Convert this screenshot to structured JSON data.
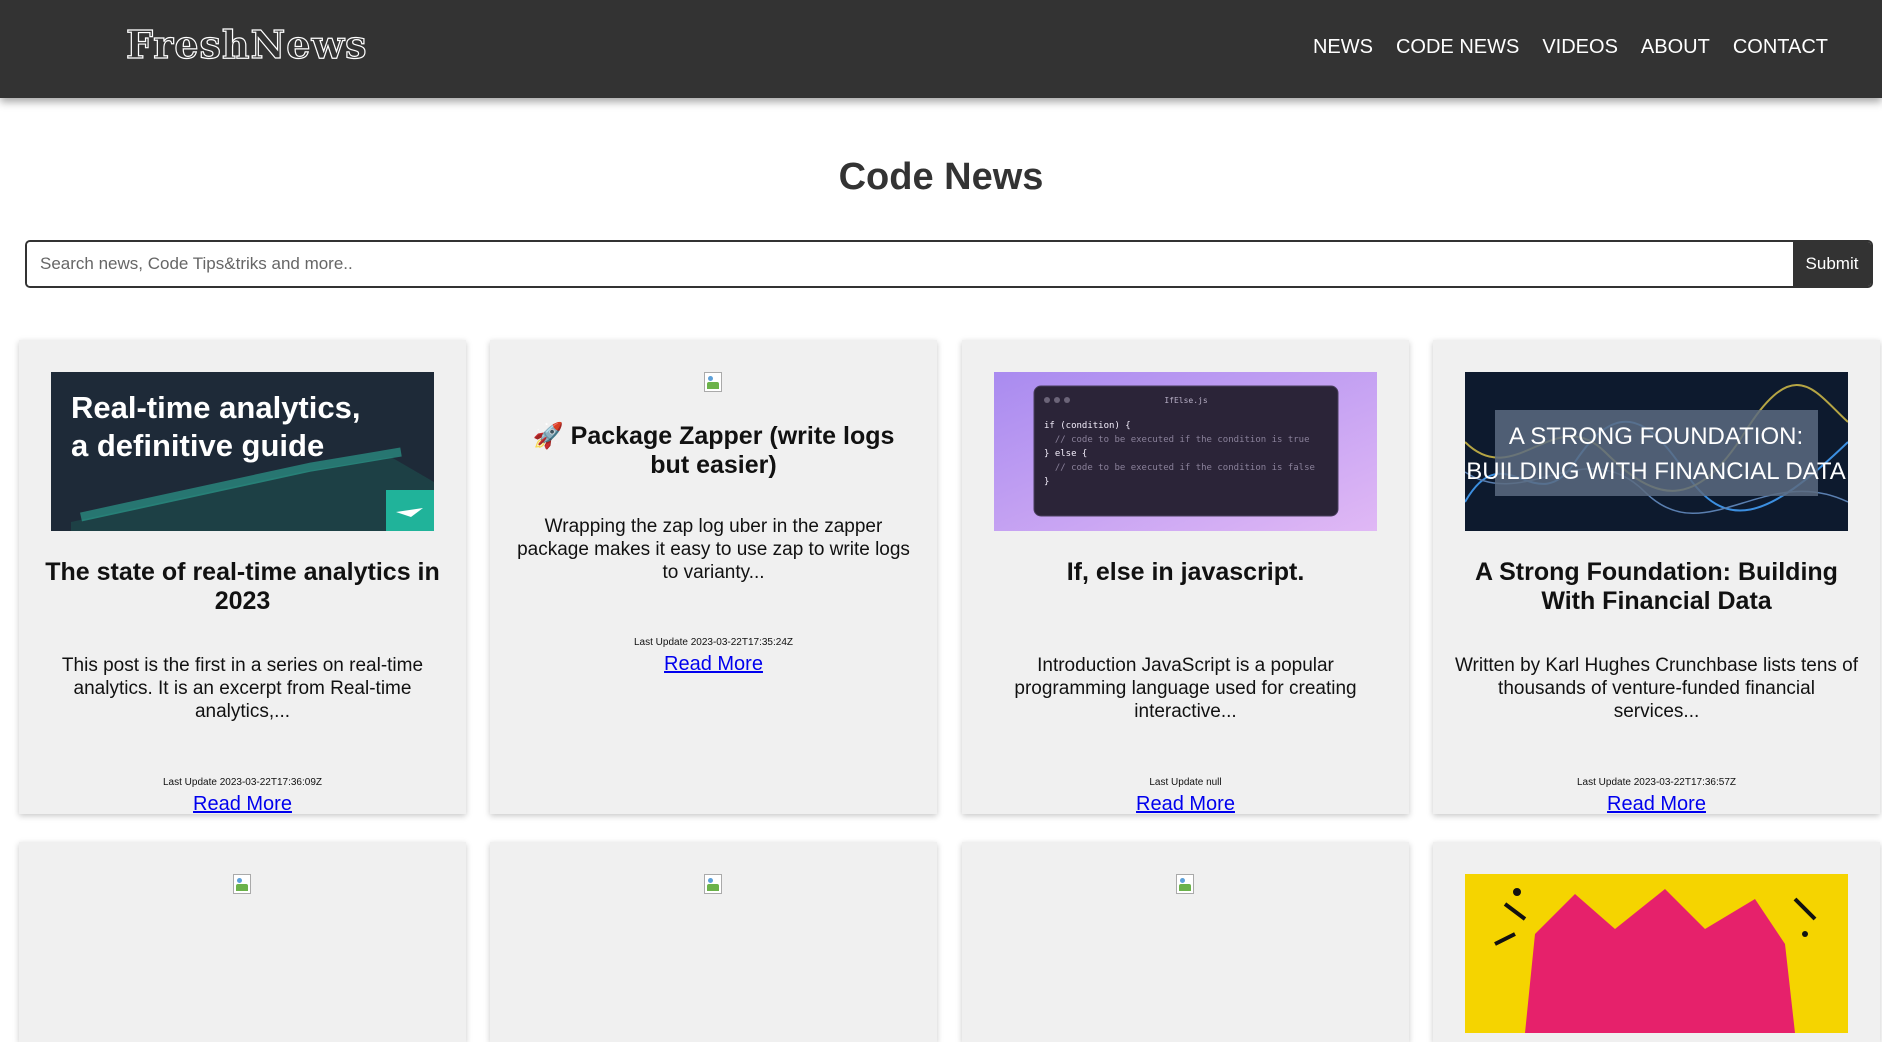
{
  "site": {
    "logo": "FreshNews"
  },
  "nav": [
    {
      "label": "NEWS"
    },
    {
      "label": "CODE NEWS"
    },
    {
      "label": "VIDEOS"
    },
    {
      "label": "ABOUT"
    },
    {
      "label": "CONTACT"
    }
  ],
  "page": {
    "title": "Code News"
  },
  "search": {
    "placeholder": "Search news, Code Tips&triks and more..",
    "submit_label": "Submit"
  },
  "articles": [
    {
      "image_text": [
        "Real-time analytics,",
        "a definitive guide"
      ],
      "title": "The state of real-time analytics in 2023",
      "description": "This post is the first in a series on real-time analytics. It is an excerpt from Real-time analytics,...",
      "updated": "Last Update 2023-03-22T17:36:09Z",
      "read_more": "Read More"
    },
    {
      "title": "🚀 Package Zapper (write logs but easier)",
      "description": "Wrapping the zap log uber in the zapper package makes it easy to use zap to write logs to varianty...",
      "updated": "Last Update 2023-03-22T17:35:24Z",
      "read_more": "Read More"
    },
    {
      "image_text": {
        "filename": "IfElse.js",
        "lines": [
          "if (condition) {",
          "  // code to be executed if the condition is true",
          "} else {",
          "  // code to be executed if the condition is false",
          "}"
        ]
      },
      "title": "If, else in javascript.",
      "description": "Introduction JavaScript is a popular programming language used for creating interactive...",
      "updated": "Last Update null",
      "read_more": "Read More"
    },
    {
      "image_text": [
        "A STRONG FOUNDATION:",
        "BUILDING WITH FINANCIAL DATA"
      ],
      "title": "A Strong Foundation: Building With Financial Data",
      "description": "Written by Karl Hughes Crunchbase lists tens of thousands of venture-funded financial services...",
      "updated": "Last Update 2023-03-22T17:36:57Z",
      "read_more": "Read More"
    }
  ],
  "colors": {
    "header_bg": "#333333",
    "card_bg": "#f0f0f0",
    "link": "#0000ee"
  }
}
